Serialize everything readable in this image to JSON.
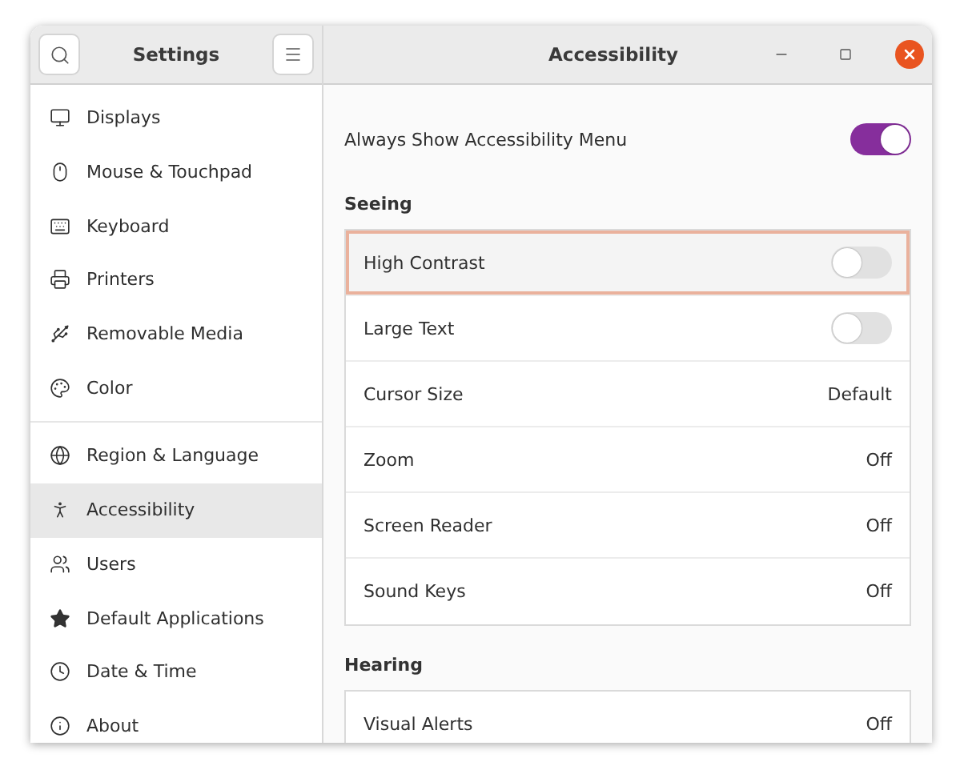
{
  "sidebar": {
    "title": "Settings",
    "groups": [
      [
        {
          "label": "Displays",
          "selected": false
        },
        {
          "label": "Mouse & Touchpad",
          "selected": false
        },
        {
          "label": "Keyboard",
          "selected": false
        },
        {
          "label": "Printers",
          "selected": false
        },
        {
          "label": "Removable Media",
          "selected": false
        },
        {
          "label": "Color",
          "selected": false
        }
      ],
      [
        {
          "label": "Region & Language",
          "selected": false
        },
        {
          "label": "Accessibility",
          "selected": true
        },
        {
          "label": "Users",
          "selected": false
        },
        {
          "label": "Default Applications",
          "selected": false
        },
        {
          "label": "Date & Time",
          "selected": false
        },
        {
          "label": "About",
          "selected": false
        }
      ]
    ]
  },
  "content": {
    "title": "Accessibility",
    "top_row": {
      "label": "Always Show Accessibility Menu",
      "kind": "switch",
      "on": true
    },
    "sections": [
      {
        "heading": "Seeing",
        "rows": [
          {
            "label": "High Contrast",
            "kind": "switch",
            "on": false,
            "focused": true
          },
          {
            "label": "Large Text",
            "kind": "switch",
            "on": false,
            "focused": false
          },
          {
            "label": "Cursor Size",
            "kind": "value",
            "value": "Default",
            "focused": false
          },
          {
            "label": "Zoom",
            "kind": "value",
            "value": "Off",
            "focused": false
          },
          {
            "label": "Screen Reader",
            "kind": "value",
            "value": "Off",
            "focused": false
          },
          {
            "label": "Sound Keys",
            "kind": "value",
            "value": "Off",
            "focused": false
          }
        ]
      },
      {
        "heading": "Hearing",
        "rows": [
          {
            "label": "Visual Alerts",
            "kind": "value",
            "value": "Off",
            "focused": false
          }
        ]
      }
    ]
  }
}
